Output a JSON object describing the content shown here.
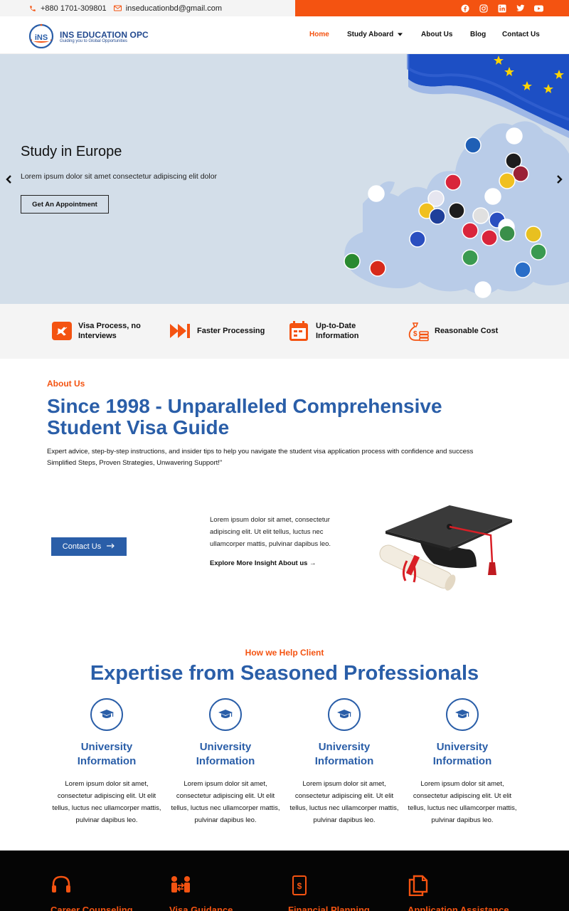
{
  "topbar": {
    "phone": "+880 1701-309801",
    "email": "inseducationbd@gmail.com",
    "social": [
      "facebook-icon",
      "instagram-icon",
      "linkedin-icon",
      "twitter-icon",
      "youtube-icon"
    ]
  },
  "brand": {
    "logo_letters": "iNS",
    "name": "INS EDUCATION OPC",
    "tagline": "Guiding you to Global Opportunities"
  },
  "nav": {
    "home": "Home",
    "study_abroad": "Study Aboard",
    "about": "About Us",
    "blog": "Blog",
    "contact": "Contact Us"
  },
  "hero": {
    "title": "Study in Europe",
    "subtitle": "Lorem ipsum dolor sit amet consectetur adipiscing elit dolor",
    "button": "Get An Appointment"
  },
  "features": [
    {
      "icon": "no-plane-icon",
      "line1": "Visa Process, no",
      "line2": "Interviews"
    },
    {
      "icon": "fast-forward-icon",
      "line1": "Faster Processing",
      "line2": ""
    },
    {
      "icon": "calendar-icon",
      "line1": "Up-to-Date",
      "line2": "Information"
    },
    {
      "icon": "money-bag-icon",
      "line1": "Reasonable Cost",
      "line2": ""
    }
  ],
  "about": {
    "label": "About Us",
    "title_line1": "Since 1998 - Unparalleled Comprehensive",
    "title_line2": "Student Visa Guide",
    "text": "Expert advice, step-by-step instructions, and insider tips to help you navigate the student visa application process with confidence and success Simplified Steps, Proven Strategies, Unwavering Support!\"",
    "contact_button": "Contact Us",
    "paragraph": "Lorem ipsum dolor sit amet, consectetur adipiscing elit. Ut elit tellus, luctus nec ullamcorper mattis, pulvinar dapibus leo.",
    "explore_link": "Explore More Insight About us →"
  },
  "help": {
    "label": "How we Help Client",
    "title": "Expertise from Seasoned Professionals",
    "services": [
      {
        "title": "University Information",
        "text": "Lorem ipsum dolor sit amet, consectetur adipiscing elit. Ut elit tellus, luctus nec ullamcorper mattis, pulvinar dapibus leo."
      },
      {
        "title": "University Information",
        "text": "Lorem ipsum dolor sit amet, consectetur adipiscing elit. Ut elit tellus, luctus nec ullamcorper mattis, pulvinar dapibus leo."
      },
      {
        "title": "University Information",
        "text": "Lorem ipsum dolor sit amet, consectetur adipiscing elit. Ut elit tellus, luctus nec ullamcorper mattis, pulvinar dapibus leo."
      },
      {
        "title": "University Information",
        "text": "Lorem ipsum dolor sit amet, consectetur adipiscing elit. Ut elit tellus, luctus nec ullamcorper mattis, pulvinar dapibus leo."
      }
    ]
  },
  "band": [
    {
      "icon": "headset-icon",
      "label": "Career Counseling"
    },
    {
      "icon": "people-exchange-icon",
      "label": "Visa Guidance"
    },
    {
      "icon": "dollar-document-icon",
      "label": "Financial Planning"
    },
    {
      "icon": "documents-copy-icon",
      "label": "Application Assistance"
    }
  ],
  "colors": {
    "accent": "#f45311",
    "primary_blue": "#2a5ea8",
    "hero_bg": "#d3dee9",
    "dark_band": "#050505"
  }
}
